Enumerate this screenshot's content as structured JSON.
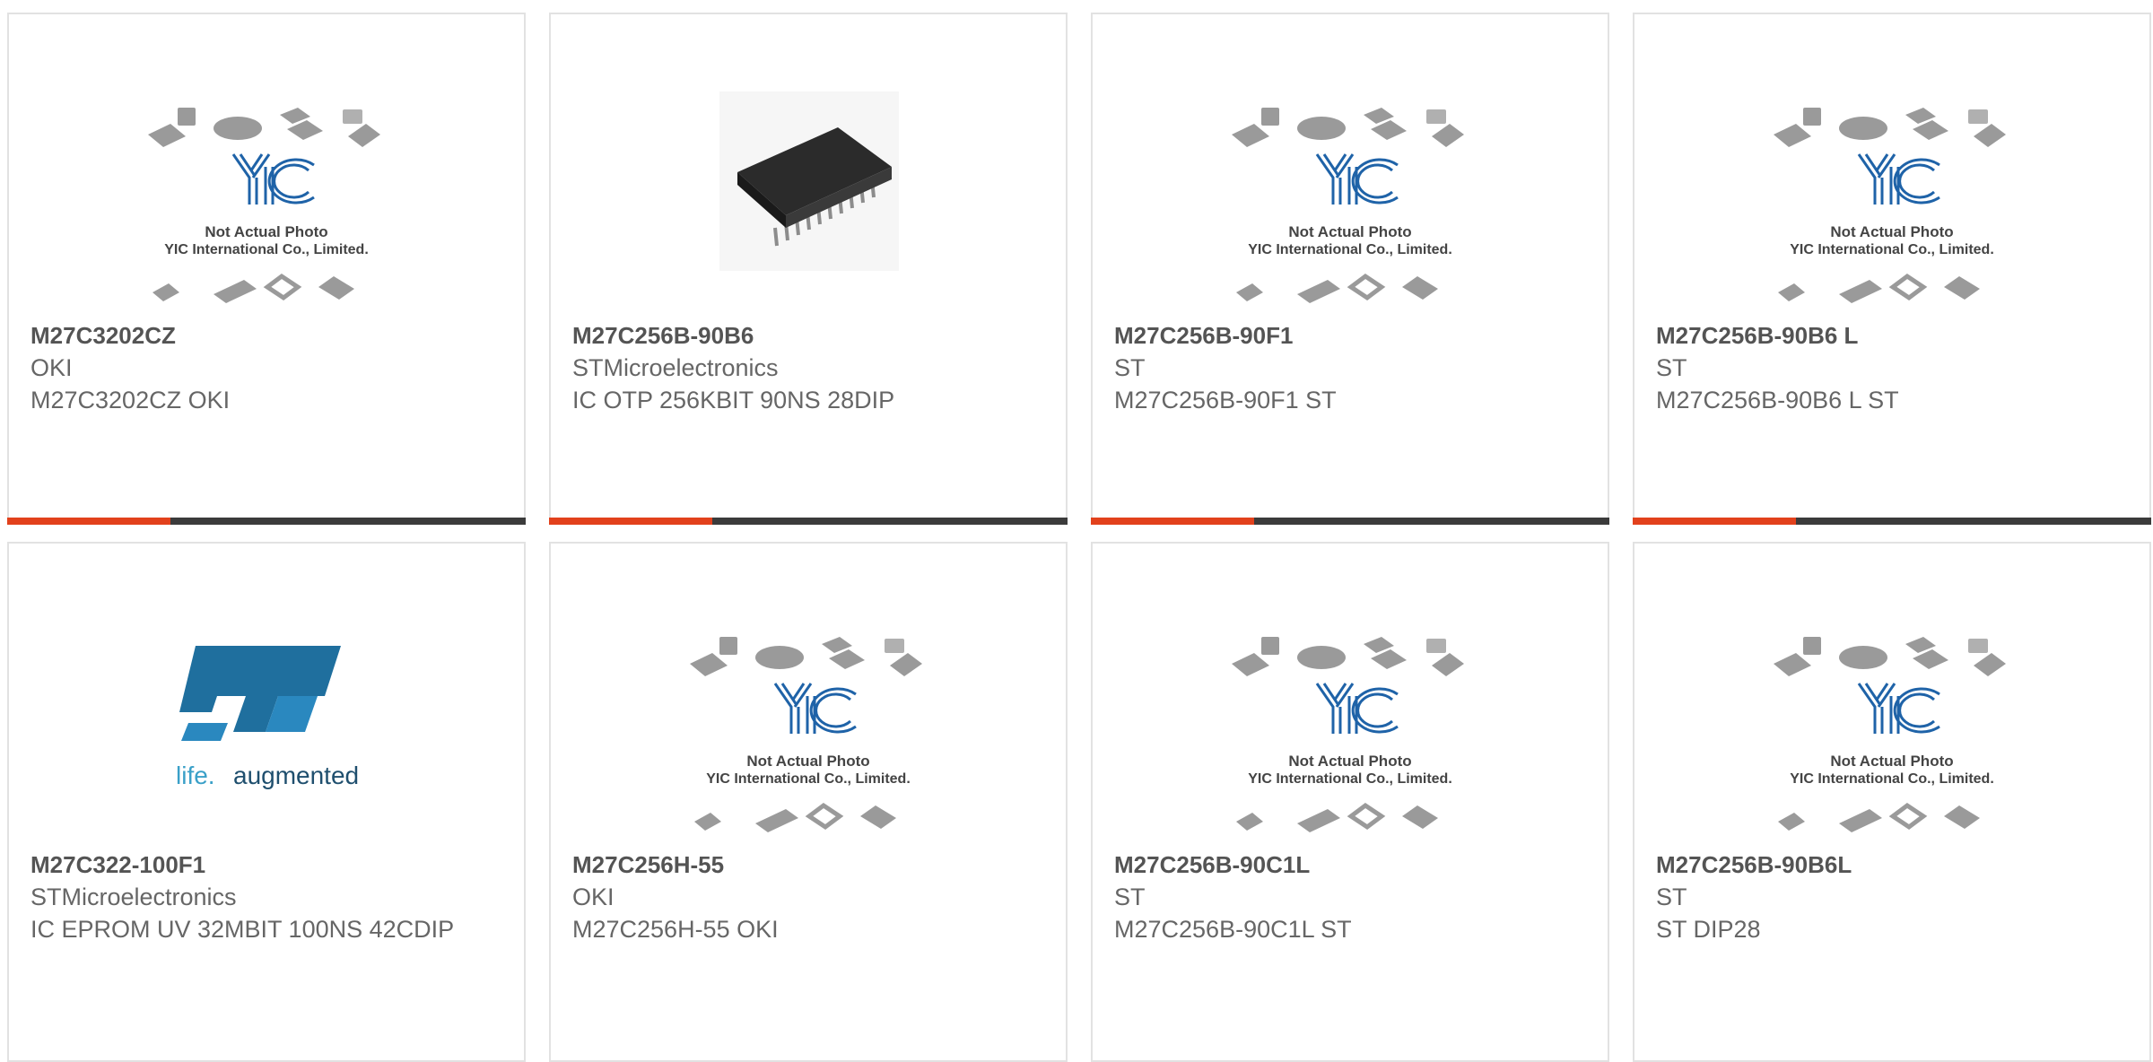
{
  "colors": {
    "accent": "#e2411c",
    "bar_dark": "#3b3b3b",
    "border": "#e2e2e2"
  },
  "placeholder": {
    "logo_text": "YIC",
    "line1": "Not Actual Photo",
    "line2": "YIC International Co., Limited."
  },
  "st_logo": {
    "text_left": "life.",
    "text_right": "augmented"
  },
  "products": [
    {
      "part": "M27C3202CZ",
      "maker": "OKI",
      "desc": "M27C3202CZ OKI",
      "image": "placeholder"
    },
    {
      "part": "M27C256B-90B6",
      "maker": "STMicroelectronics",
      "desc": "IC OTP 256KBIT 90NS 28DIP",
      "image": "dip-chip"
    },
    {
      "part": "M27C256B-90F1",
      "maker": "ST",
      "desc": "M27C256B-90F1 ST",
      "image": "placeholder"
    },
    {
      "part": "M27C256B-90B6 L",
      "maker": "ST",
      "desc": "M27C256B-90B6 L ST",
      "image": "placeholder"
    },
    {
      "part": "M27C322-100F1",
      "maker": "STMicroelectronics",
      "desc": "IC EPROM UV 32MBIT 100NS 42CDIP",
      "image": "st-logo"
    },
    {
      "part": "M27C256H-55",
      "maker": "OKI",
      "desc": "M27C256H-55 OKI",
      "image": "placeholder"
    },
    {
      "part": "M27C256B-90C1L",
      "maker": "ST",
      "desc": "M27C256B-90C1L ST",
      "image": "placeholder"
    },
    {
      "part": "M27C256B-90B6L",
      "maker": "ST",
      "desc": "ST DIP28",
      "image": "placeholder"
    }
  ]
}
